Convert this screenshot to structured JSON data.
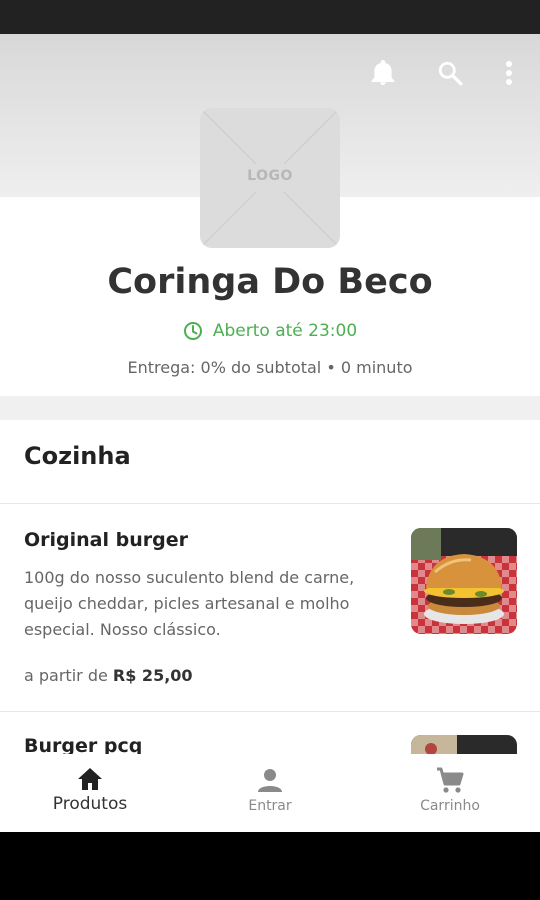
{
  "header": {
    "icons": [
      "bell-icon",
      "search-icon",
      "more-vert-icon"
    ],
    "logo_text": "LOGO"
  },
  "store": {
    "name": "Coringa Do Beco",
    "status": "Aberto até 23:00",
    "delivery": "Entrega: 0% do subtotal • 0 minuto",
    "status_color": "#4caf50"
  },
  "section": {
    "title": "Cozinha"
  },
  "items": [
    {
      "name": "Original burger",
      "description": "100g do nosso suculento blend de carne, queijo cheddar, picles artesanal e molho especial. Nosso clássico.",
      "price_prefix": "a partir de",
      "price": "R$ 25,00"
    },
    {
      "name": "Burger pcq"
    }
  ],
  "nav": [
    {
      "label": "Produtos",
      "icon": "home-icon",
      "active": true
    },
    {
      "label": "Entrar",
      "icon": "person-icon",
      "active": false
    },
    {
      "label": "Carrinho",
      "icon": "cart-icon",
      "active": false
    }
  ]
}
